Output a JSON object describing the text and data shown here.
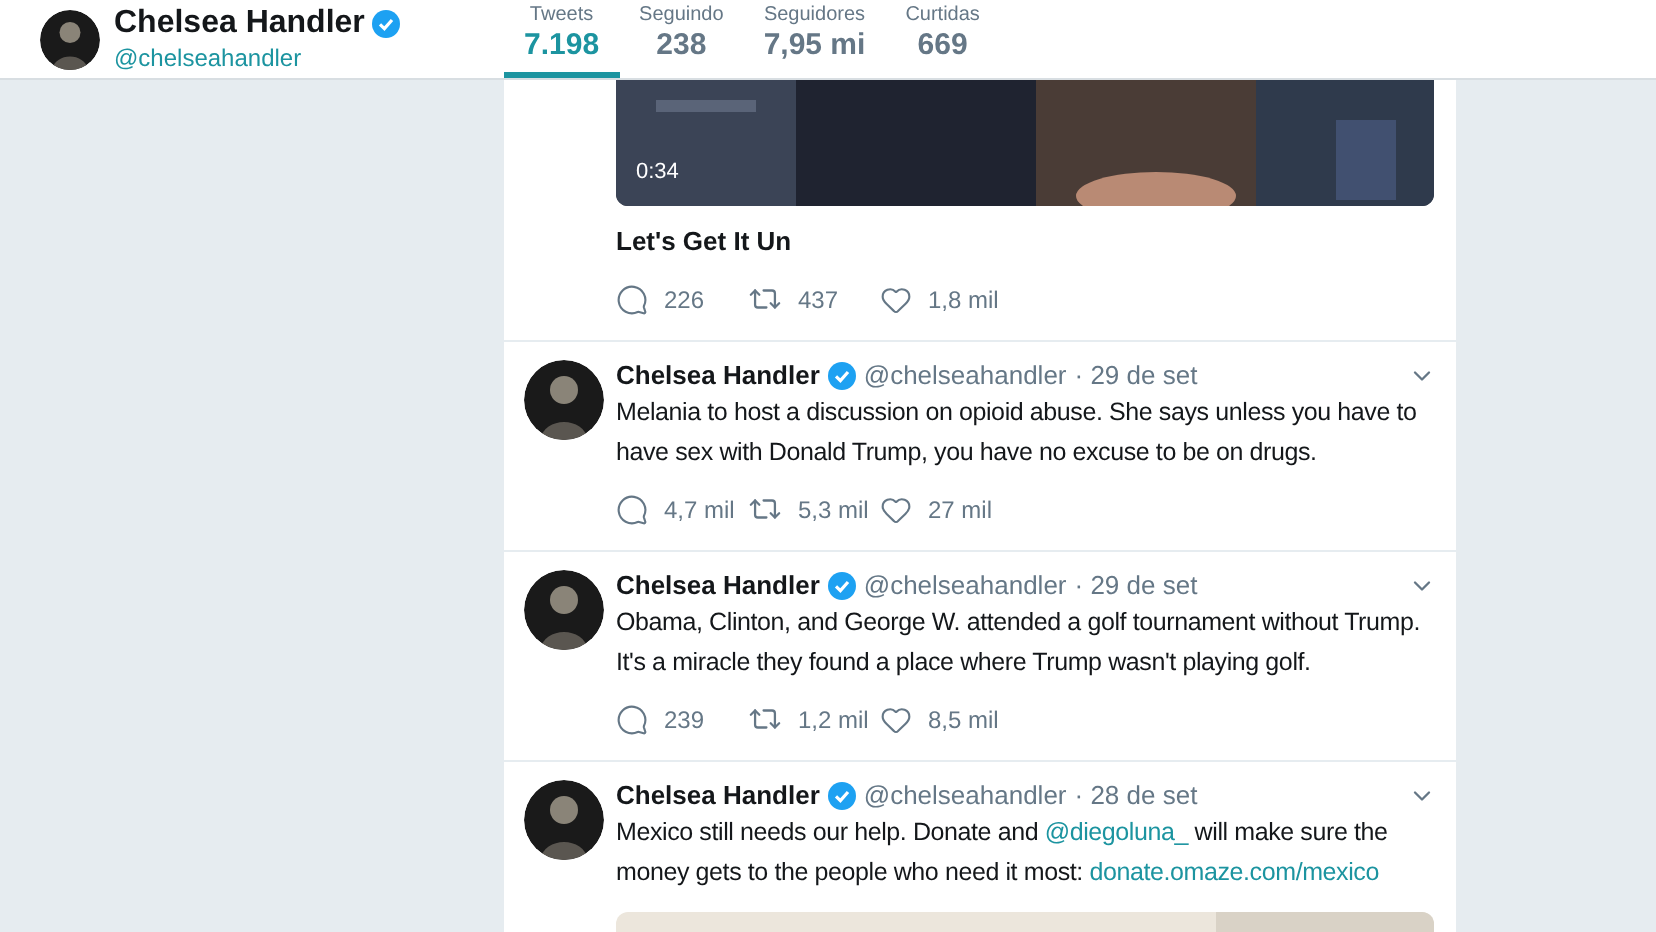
{
  "profile": {
    "name": "Chelsea Handler",
    "verified": true,
    "handle": "@chelseahandler"
  },
  "stats": [
    {
      "label": "Tweets",
      "value": "7.198",
      "selected": true
    },
    {
      "label": "Seguindo",
      "value": "238",
      "selected": false
    },
    {
      "label": "Seguidores",
      "value": "7,95 mi",
      "selected": false
    },
    {
      "label": "Curtidas",
      "value": "669",
      "selected": false
    }
  ],
  "tweets": [
    {
      "media": {
        "kind": "video",
        "duration": "0:34"
      },
      "card_title": "Let's Get It Un",
      "replies": "226",
      "retweets": "437",
      "likes": "1,8 mil"
    },
    {
      "name": "Chelsea Handler",
      "verified": true,
      "handle": "@chelseahandler",
      "date": "· 29 de set",
      "text": [
        {
          "text": "Melania to host a discussion on opioid abuse. She says unless you have to have sex with Donald Trump, you have no excuse to be on drugs.",
          "link": false
        }
      ],
      "replies": "4,7 mil",
      "retweets": "5,3 mil",
      "likes": "27 mil"
    },
    {
      "name": "Chelsea Handler",
      "verified": true,
      "handle": "@chelseahandler",
      "date": "· 29 de set",
      "text": [
        {
          "text": "Obama, Clinton, and George W. attended a golf tournament without Trump. It's a miracle they found a place where Trump wasn't playing golf.",
          "link": false
        }
      ],
      "replies": "239",
      "retweets": "1,2 mil",
      "likes": "8,5 mil"
    },
    {
      "name": "Chelsea Handler",
      "verified": true,
      "handle": "@chelseahandler",
      "date": "· 28 de set",
      "text": [
        {
          "text": "Mexico still needs our help. Donate and ",
          "link": false
        },
        {
          "text": "@diegoluna_",
          "link": true
        },
        {
          "text": " will make sure the money gets to the people who need it most: ",
          "link": false
        },
        {
          "text": "donate.omaze.com/mexico",
          "link": true
        }
      ]
    }
  ]
}
